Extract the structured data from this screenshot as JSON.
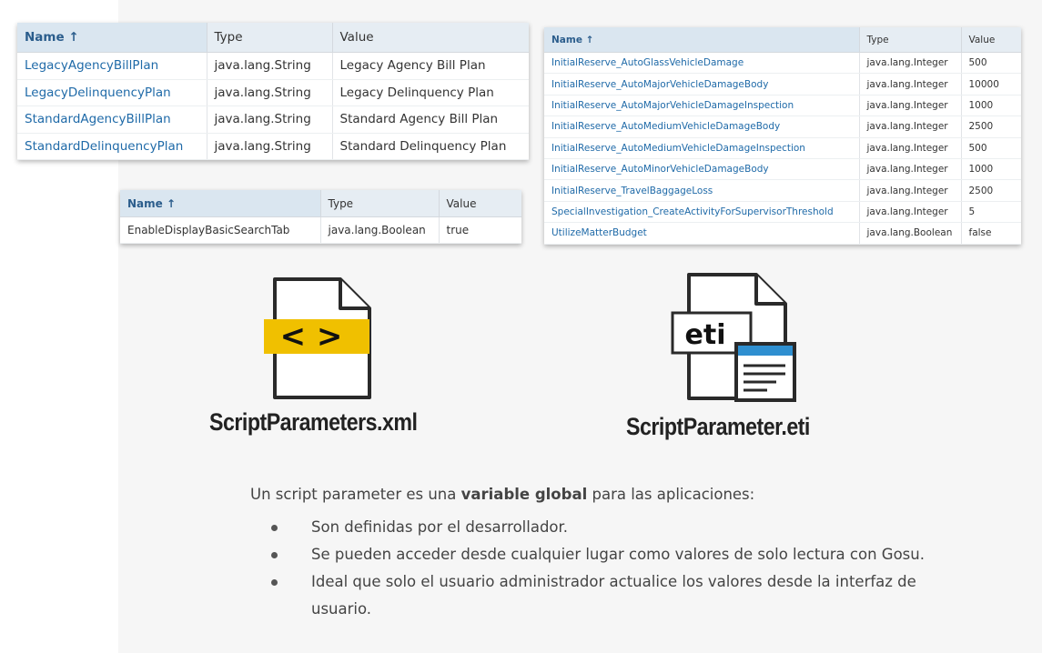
{
  "tables": {
    "t1": {
      "headers": {
        "name": "Name ↑",
        "type": "Type",
        "value": "Value"
      },
      "rows": [
        {
          "name": "LegacyAgencyBillPlan",
          "type": "java.lang.String",
          "value": "Legacy Agency Bill Plan"
        },
        {
          "name": "LegacyDelinquencyPlan",
          "type": "java.lang.String",
          "value": "Legacy Delinquency Plan"
        },
        {
          "name": "StandardAgencyBillPlan",
          "type": "java.lang.String",
          "value": "Standard Agency Bill Plan"
        },
        {
          "name": "StandardDelinquencyPlan",
          "type": "java.lang.String",
          "value": "Standard Delinquency Plan"
        }
      ]
    },
    "t2": {
      "headers": {
        "name": "Name ↑",
        "type": "Type",
        "value": "Value"
      },
      "rows": [
        {
          "name": "EnableDisplayBasicSearchTab",
          "type": "java.lang.Boolean",
          "value": "true"
        }
      ]
    },
    "t3": {
      "headers": {
        "name": "Name ↑",
        "type": "Type",
        "value": "Value"
      },
      "rows": [
        {
          "name": "InitialReserve_AutoGlassVehicleDamage",
          "type": "java.lang.Integer",
          "value": "500"
        },
        {
          "name": "InitialReserve_AutoMajorVehicleDamageBody",
          "type": "java.lang.Integer",
          "value": "10000"
        },
        {
          "name": "InitialReserve_AutoMajorVehicleDamageInspection",
          "type": "java.lang.Integer",
          "value": "1000"
        },
        {
          "name": "InitialReserve_AutoMediumVehicleDamageBody",
          "type": "java.lang.Integer",
          "value": "2500"
        },
        {
          "name": "InitialReserve_AutoMediumVehicleDamageInspection",
          "type": "java.lang.Integer",
          "value": "500"
        },
        {
          "name": "InitialReserve_AutoMinorVehicleDamageBody",
          "type": "java.lang.Integer",
          "value": "1000"
        },
        {
          "name": "InitialReserve_TravelBaggageLoss",
          "type": "java.lang.Integer",
          "value": "2500"
        },
        {
          "name": "SpecialInvestigation_CreateActivityForSupervisorThreshold",
          "type": "java.lang.Integer",
          "value": "5"
        },
        {
          "name": "UtilizeMatterBudget",
          "type": "java.lang.Boolean",
          "value": "false"
        }
      ]
    }
  },
  "files": {
    "xml": {
      "icon_text": "< >",
      "caption": "ScriptParameters.xml",
      "icon": "xml-file-icon",
      "accent": "#f0c000"
    },
    "eti": {
      "icon_text": "eti",
      "caption": "ScriptParameter.eti",
      "icon": "eti-file-icon",
      "accent": "#2f8fd0"
    }
  },
  "description": {
    "intro_before": "Un script parameter es una ",
    "intro_bold": "variable global",
    "intro_after": " para las aplicaciones:",
    "bullets": [
      "Son definidas por el desarrollador.",
      "Se pueden acceder desde cualquier lugar como valores de solo lectura con Gosu.",
      "Ideal que solo el  usuario administrador actualice los valores desde la interfaz de usuario."
    ]
  },
  "colors": {
    "header_bg": "#e6edf3",
    "link": "#1f6aa8",
    "slide_bg": "#f6f6f6"
  }
}
